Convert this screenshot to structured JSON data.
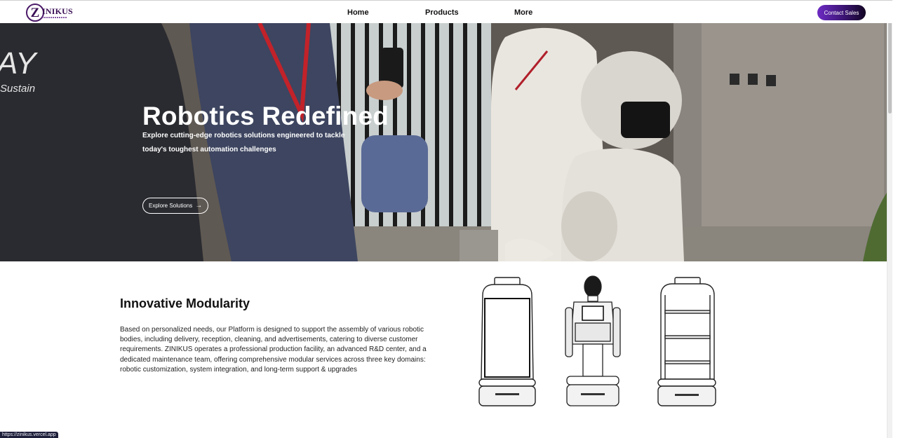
{
  "header": {
    "logo_letter": "Z",
    "logo_word": "INIKUS",
    "nav": {
      "home": "Home",
      "products": "Products",
      "more": "More"
    },
    "contact_label": "Contact Sales"
  },
  "hero": {
    "backdrop_text": "AY",
    "backdrop_text_2": "Sustain",
    "title": "Robotics Redefined",
    "subtitle": "Explore cutting-edge robotics solutions engineered to tackle today's toughest automation challenges",
    "cta_label": "Explore Solutions",
    "cta_icon": "arrow-right-icon"
  },
  "modularity": {
    "title": "Innovative Modularity",
    "body": "Based on personalized needs, our Platform is designed to support the assembly of various robotic bodies, including delivery, reception, cleaning, and advertisements, catering to diverse customer requirements. ZINIKUS operates a professional production facility, an advanced R&D center, and a dedicated maintenance team, offering comprehensive modular services across three key domains: robotic customization, system integration, and long-term support & upgrades"
  },
  "status": {
    "url": "https://zinikus.vercel.app"
  },
  "colors": {
    "brand": "#3a0f55",
    "cta_start": "#6d2bc4",
    "cta_end": "#120622"
  }
}
